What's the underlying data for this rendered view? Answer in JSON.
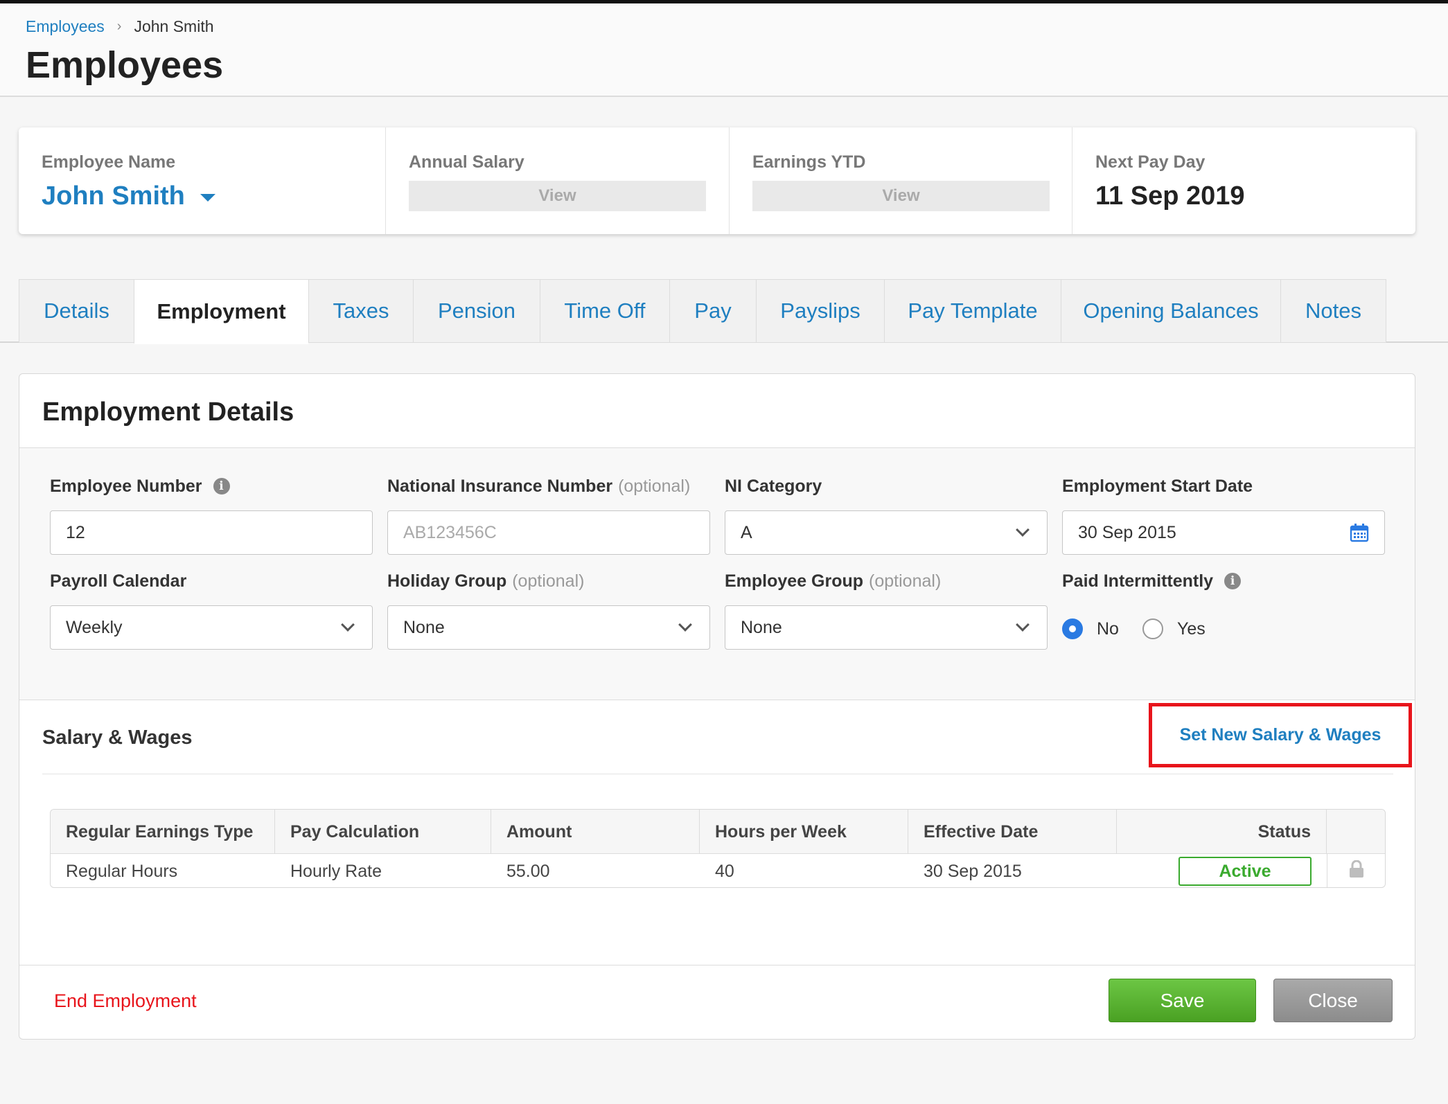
{
  "breadcrumb": {
    "parent": "Employees",
    "separator": "›",
    "current": "John Smith"
  },
  "page_title": "Employees",
  "summary": {
    "employee_name_label": "Employee Name",
    "employee_name": "John Smith",
    "annual_salary_label": "Annual Salary",
    "annual_salary_view": "View",
    "earnings_ytd_label": "Earnings YTD",
    "earnings_ytd_view": "View",
    "next_pay_day_label": "Next Pay Day",
    "next_pay_day": "11 Sep 2019"
  },
  "tabs": [
    {
      "label": "Details"
    },
    {
      "label": "Employment",
      "active": true
    },
    {
      "label": "Taxes"
    },
    {
      "label": "Pension"
    },
    {
      "label": "Time Off"
    },
    {
      "label": "Pay"
    },
    {
      "label": "Payslips"
    },
    {
      "label": "Pay Template"
    },
    {
      "label": "Opening Balances"
    },
    {
      "label": "Notes"
    }
  ],
  "employment_details": {
    "title": "Employment Details",
    "employee_number": {
      "label": "Employee Number",
      "value": "12"
    },
    "ni_number": {
      "label": "National Insurance Number",
      "optional": "(optional)",
      "placeholder": "AB123456C"
    },
    "ni_category": {
      "label": "NI Category",
      "value": "A"
    },
    "start_date": {
      "label": "Employment Start Date",
      "value": "30 Sep 2015"
    },
    "payroll_calendar": {
      "label": "Payroll Calendar",
      "value": "Weekly"
    },
    "holiday_group": {
      "label": "Holiday Group",
      "optional": "(optional)",
      "value": "None"
    },
    "employee_group": {
      "label": "Employee Group",
      "optional": "(optional)",
      "value": "None"
    },
    "paid_intermittently": {
      "label": "Paid Intermittently",
      "no": "No",
      "yes": "Yes",
      "selected": "No"
    }
  },
  "salary_wages": {
    "title": "Salary & Wages",
    "set_new_link": "Set New Salary & Wages",
    "columns": [
      "Regular Earnings Type",
      "Pay Calculation",
      "Amount",
      "Hours per Week",
      "Effective Date",
      "Status"
    ],
    "rows": [
      {
        "type": "Regular Hours",
        "calculation": "Hourly Rate",
        "amount": "55.00",
        "hours": "40",
        "effective_date": "30 Sep 2015",
        "status": "Active"
      }
    ]
  },
  "footer": {
    "end_employment": "End Employment",
    "save": "Save",
    "close": "Close"
  },
  "colors": {
    "link_blue": "#1f7fc0",
    "active_green": "#3aaa2e",
    "save_green": "#4aa123",
    "highlight_red": "#e8141b",
    "radio_blue": "#2a7ae2"
  }
}
